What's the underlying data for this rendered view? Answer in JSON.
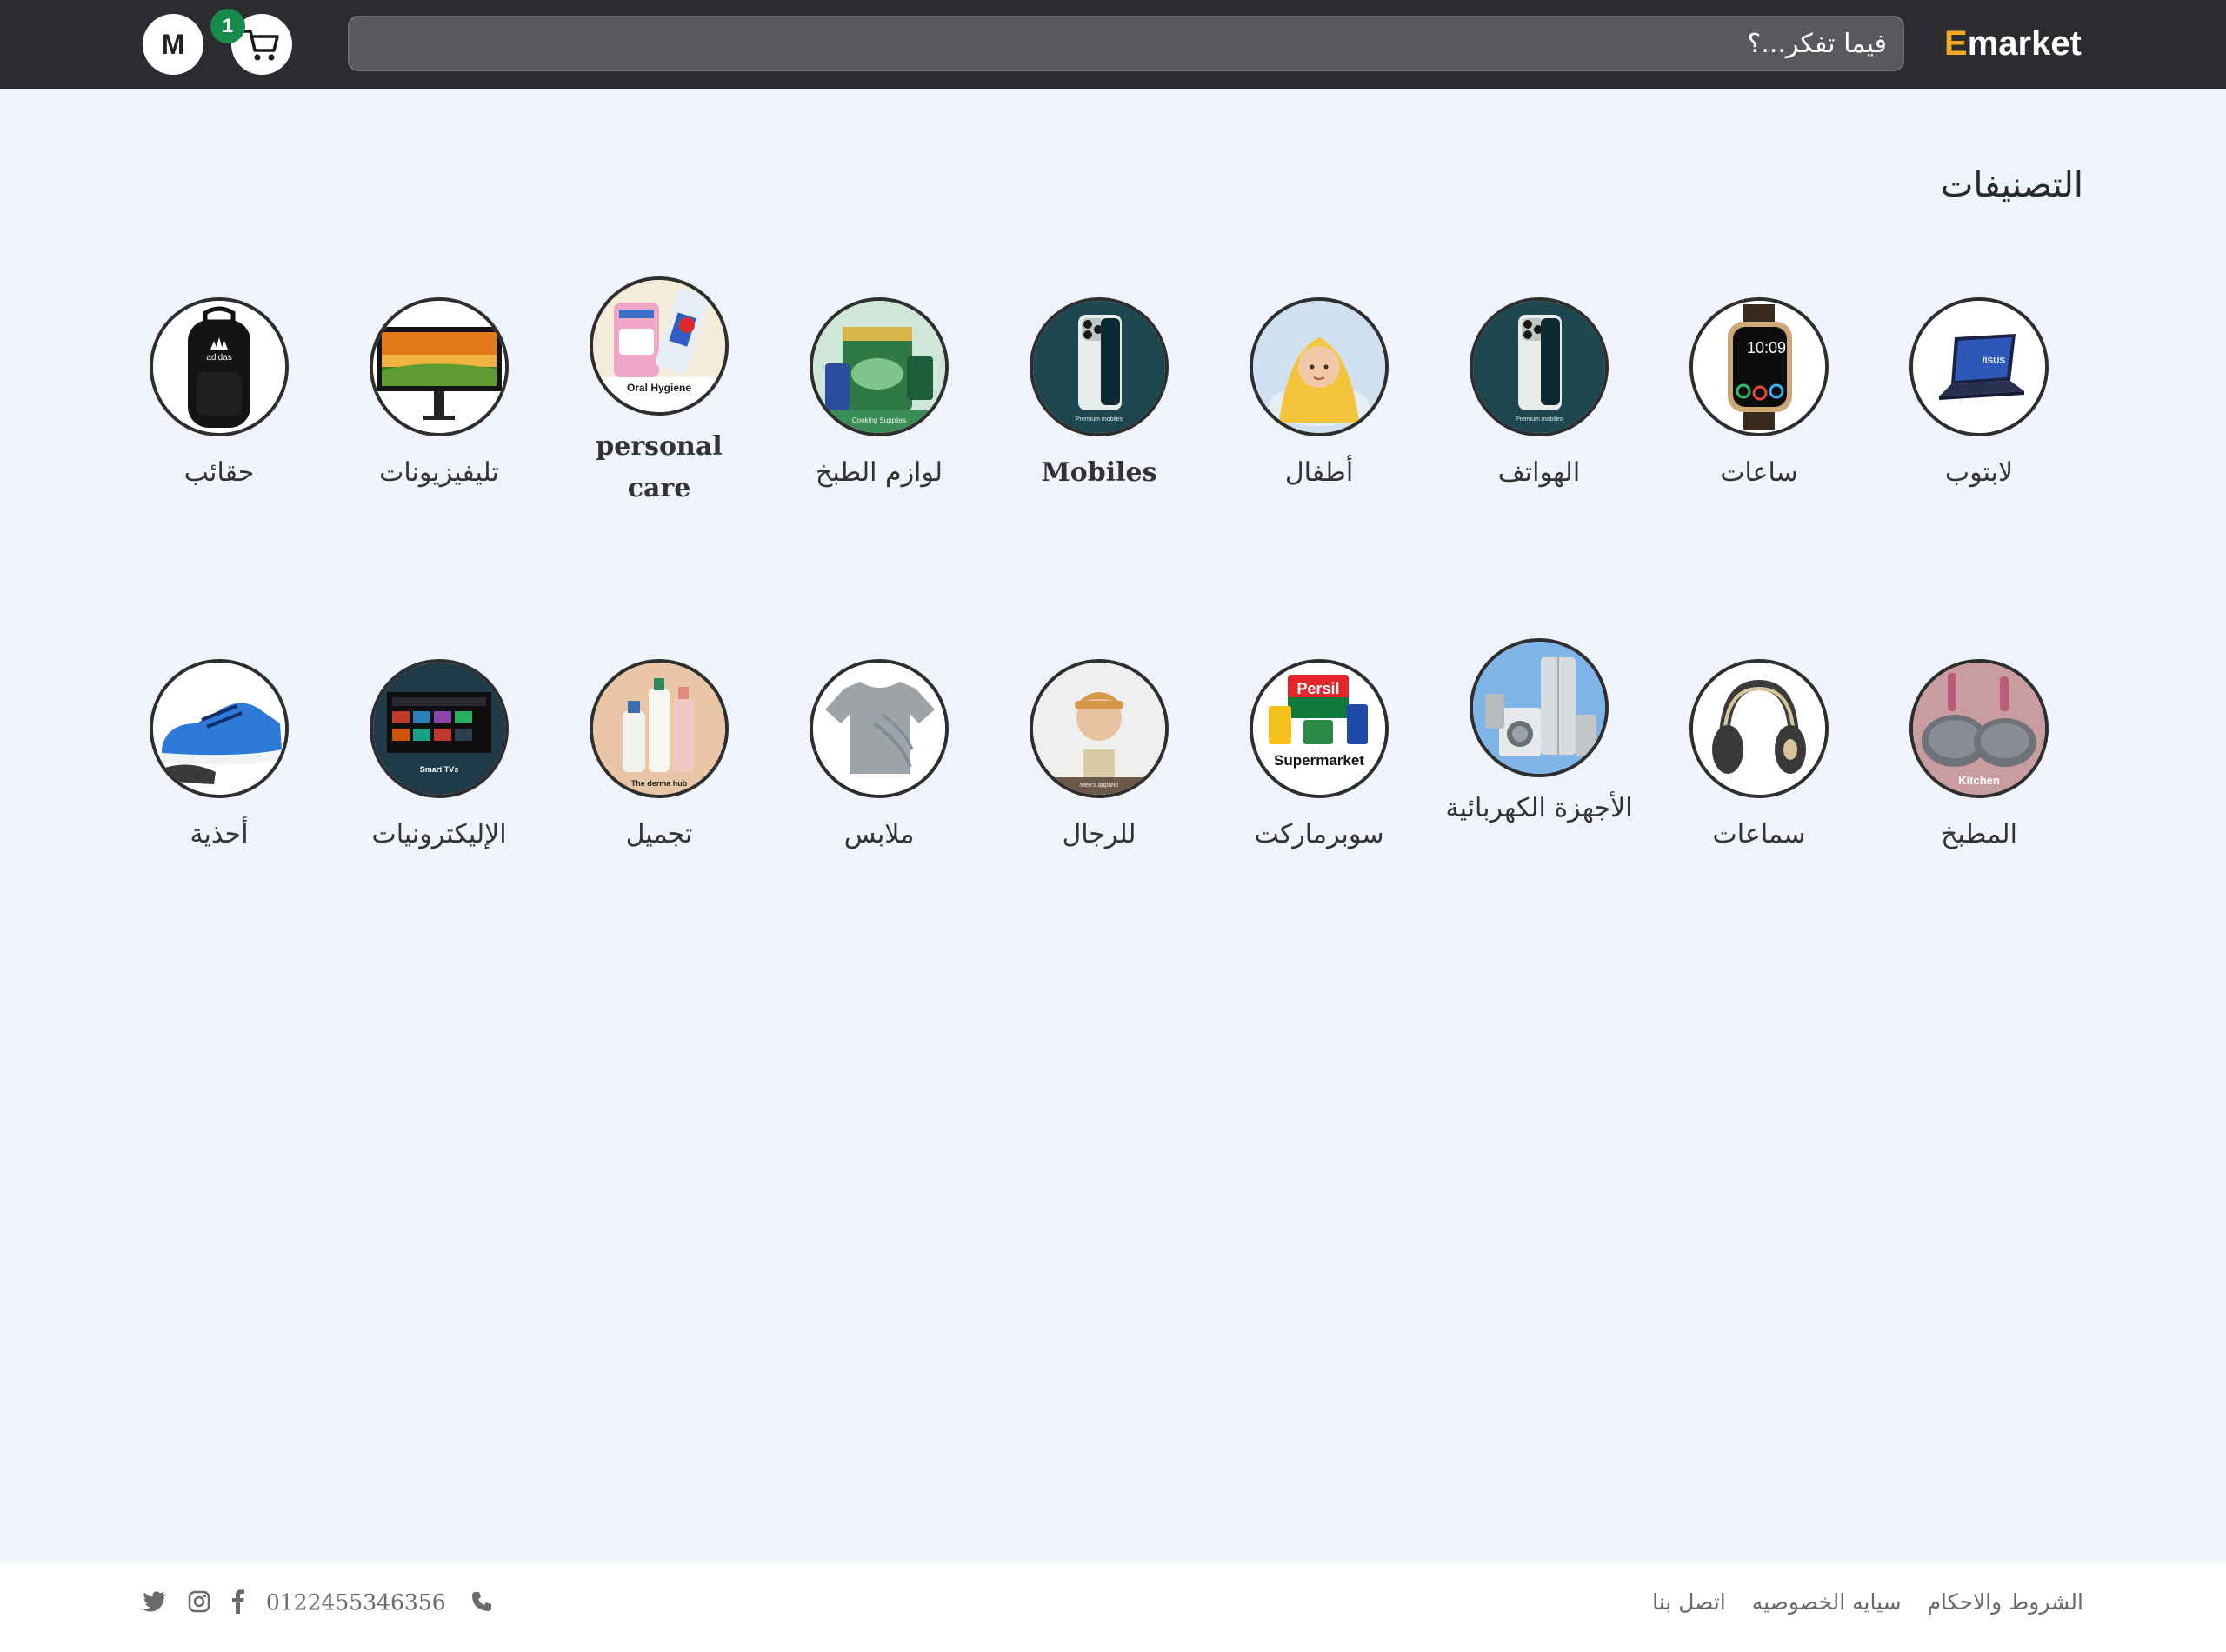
{
  "header": {
    "brand_first": "E",
    "brand_rest": "market",
    "search_placeholder": "فيما تفكر...؟",
    "avatar_letter": "M",
    "cart_count": "1"
  },
  "categories_title": "التصنيفات",
  "categories": [
    {
      "label": "لابتوب",
      "icon": "laptop-icon"
    },
    {
      "label": "ساعات",
      "icon": "smartwatch-icon"
    },
    {
      "label": "الهواتف",
      "icon": "phone-icon",
      "caption": "Premium mobiles"
    },
    {
      "label": "أطفال",
      "icon": "baby-icon"
    },
    {
      "label": "Mobiles",
      "icon": "phone-icon",
      "caption": "Premium mobiles"
    },
    {
      "label": "لوازم الطبخ",
      "icon": "cooking-supplies-icon",
      "caption": "Cooking Supplies"
    },
    {
      "label": "personal care",
      "icon": "oral-hygiene-icon",
      "caption": "Oral Hygiene"
    },
    {
      "label": "تليفيزيونات",
      "icon": "monitor-icon"
    },
    {
      "label": "حقائب",
      "icon": "backpack-icon",
      "caption": "adidas"
    },
    {
      "label": "المطبخ",
      "icon": "pans-icon",
      "caption": "Kitchen"
    },
    {
      "label": "سماعات",
      "icon": "headphones-icon"
    },
    {
      "label": "الأجهزة الكهربائية",
      "icon": "appliances-icon"
    },
    {
      "label": "سوبرماركت",
      "icon": "supermarket-icon",
      "caption": "Supermarket",
      "brand": "Persil"
    },
    {
      "label": "للرجال",
      "icon": "man-icon",
      "caption": "Men's apparel"
    },
    {
      "label": "ملابس",
      "icon": "tshirt-icon"
    },
    {
      "label": "تجميل",
      "icon": "skincare-icon",
      "caption": "The derma hub"
    },
    {
      "label": "الإليكترونيات",
      "icon": "smart-tv-icon",
      "caption": "Smart TVs"
    },
    {
      "label": "أحذية",
      "icon": "sneaker-icon"
    }
  ],
  "watch_time": "10:09",
  "footer": {
    "terms": "الشروط والاحكام",
    "privacy": "سيايه الخصوصيه",
    "contact": "اتصل بنا",
    "phone": "0122455346356"
  }
}
